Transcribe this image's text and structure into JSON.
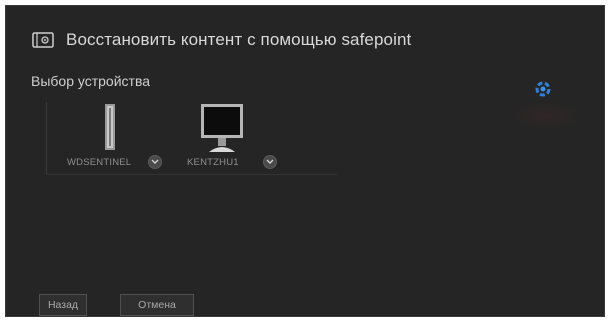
{
  "dialog": {
    "title": "Восстановить контент с помощью safepoint",
    "title_icon": "safepoint-restore-icon"
  },
  "device_selection": {
    "label": "Выбор устройства",
    "devices": [
      {
        "name": "WDSENTINEL",
        "icon": "nas-tower-icon"
      },
      {
        "name": "KENTZHU1",
        "icon": "monitor-icon"
      }
    ]
  },
  "status": {
    "icon": "loading-spinner-icon",
    "accent_color": "#2f7fd8"
  },
  "footer": {
    "back_label": "Назад",
    "cancel_label": "Отмена"
  }
}
